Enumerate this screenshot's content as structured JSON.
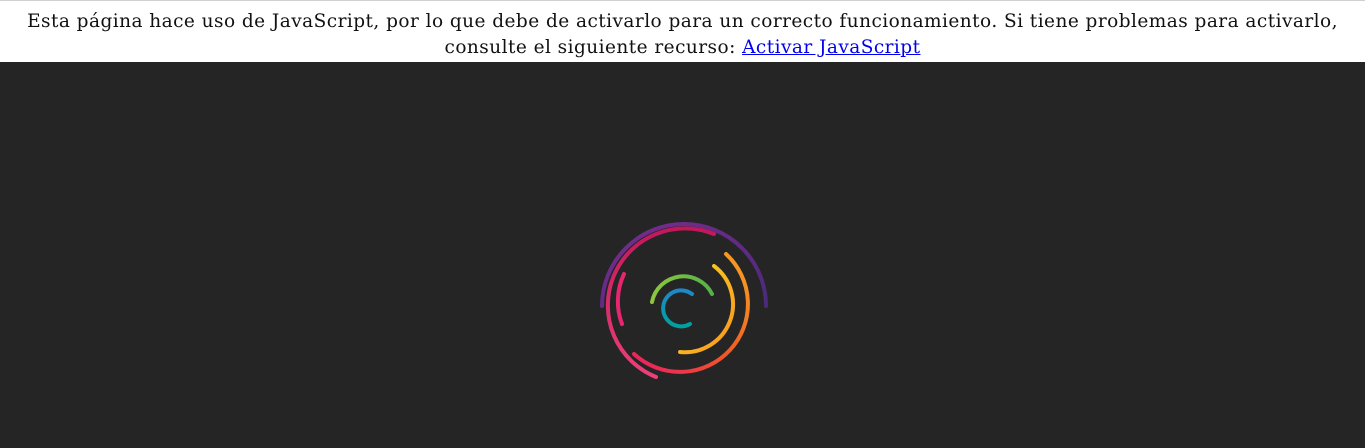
{
  "notice": {
    "line1": "Esta página hace uso de JavaScript, por lo que debe de activarlo para un correcto funcionamiento. Si tiene problemas para activarlo,",
    "line2_prefix": "consulte el siguiente recurso: ",
    "link_text": "Activar JavaScript"
  },
  "loader": {
    "background": "#252525",
    "ring_colors": {
      "outer": "#5b2a86",
      "second_a": "#d81e5b",
      "second_b": "#e8256f",
      "third_a": "#f15a24",
      "third_b": "#ed1e79",
      "fourth_a": "#f7b733",
      "fourth_b": "#fc4a1a",
      "inner_a": "#8cc63f",
      "inner_b": "#39b54a",
      "core": "#1e88c8"
    }
  }
}
